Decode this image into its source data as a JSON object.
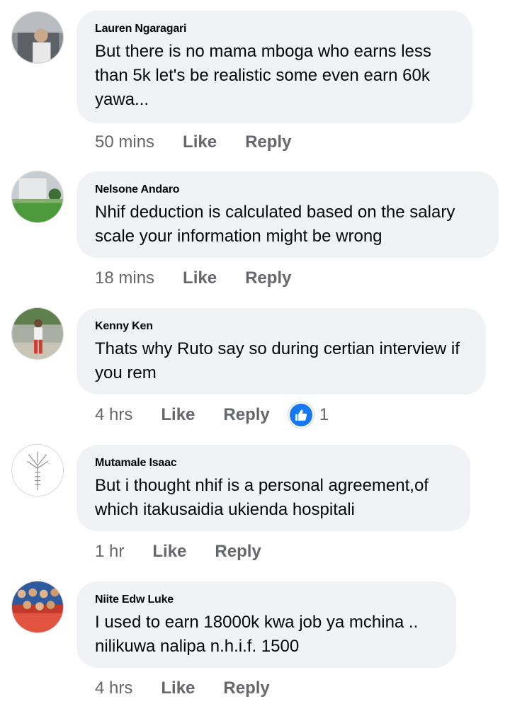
{
  "comments": [
    {
      "author": "Lauren Ngaragari",
      "text": "But there is no mama mboga who earns less than 5k let's be realistic some even earn 60k yawa...",
      "time": "50 mins",
      "like_label": "Like",
      "reply_label": "Reply"
    },
    {
      "author": "Nelsone Andaro",
      "text": "Nhif deduction is calculated based on the salary scale your information might be wrong",
      "time": "18 mins",
      "like_label": "Like",
      "reply_label": "Reply"
    },
    {
      "author": "Kenny Ken",
      "text": "Thats why Ruto say so during certian interview if you rem",
      "time": "4 hrs",
      "like_label": "Like",
      "reply_label": "Reply",
      "reaction_icon": "like-thumb-icon",
      "reaction_count": "1"
    },
    {
      "author": "Mutamale Isaac",
      "text": "But i thought nhif is a personal agreement,of which itakusaidia ukienda hospitali",
      "time": "1 hr",
      "like_label": "Like",
      "reply_label": "Reply"
    },
    {
      "author": "Niite Edw Luke",
      "text": "I used to earn 18000k kwa job ya mchina .. nilikuwa nalipa n.h.i.f. 1500",
      "time": "4 hrs",
      "like_label": "Like",
      "reply_label": "Reply"
    }
  ],
  "colors": {
    "bubble": "#f0f2f5",
    "meta_text": "#65676b",
    "like_blue": "#1877f2"
  }
}
